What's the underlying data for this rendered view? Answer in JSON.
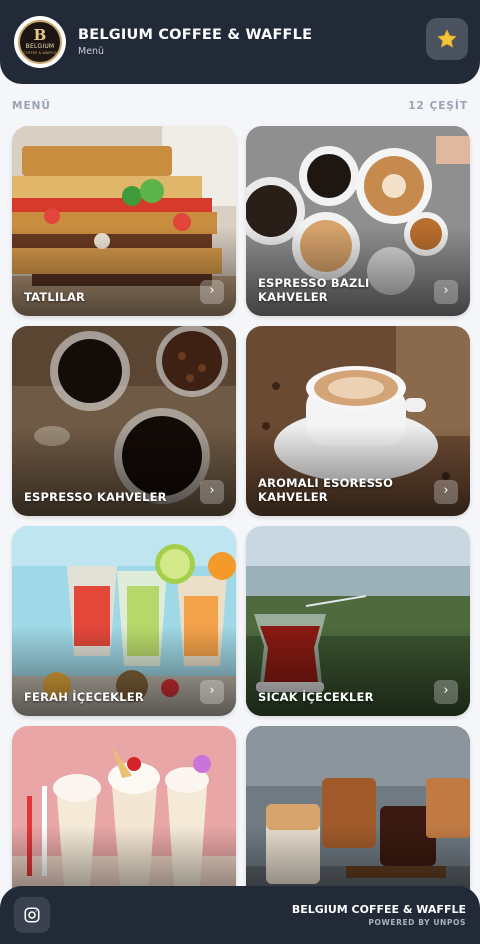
{
  "header": {
    "brand": "BELGIUM COFFEE & WAFFLE",
    "subtitle": "Menü",
    "logo": {
      "letter": "B",
      "name": "BELGIUM",
      "tagline": "COFFEE & WAFFLE"
    },
    "favorite_icon": "star-icon"
  },
  "section": {
    "title": "MENÜ",
    "count": "12 ÇEŞİT"
  },
  "categories": [
    {
      "label": "TATLILAR"
    },
    {
      "label": "ESPRESSO BAZLI KAHVELER"
    },
    {
      "label": "ESPRESSO KAHVELER"
    },
    {
      "label": "AROMALI ESORESSO KAHVELER"
    },
    {
      "label": "FERAH İÇECEKLER"
    },
    {
      "label": "SICAK İÇECEKLER"
    },
    {
      "label": ""
    },
    {
      "label": ""
    }
  ],
  "card_arrow": "›",
  "footer": {
    "brand": "BELGIUM COFFEE & WAFFLE",
    "powered": "POWERED BY UNPOS",
    "social_icon": "instagram-icon"
  },
  "colors": {
    "header_bg": "#222a38",
    "page_bg": "#f4f6f9",
    "accent_star": "#f2c53d"
  }
}
